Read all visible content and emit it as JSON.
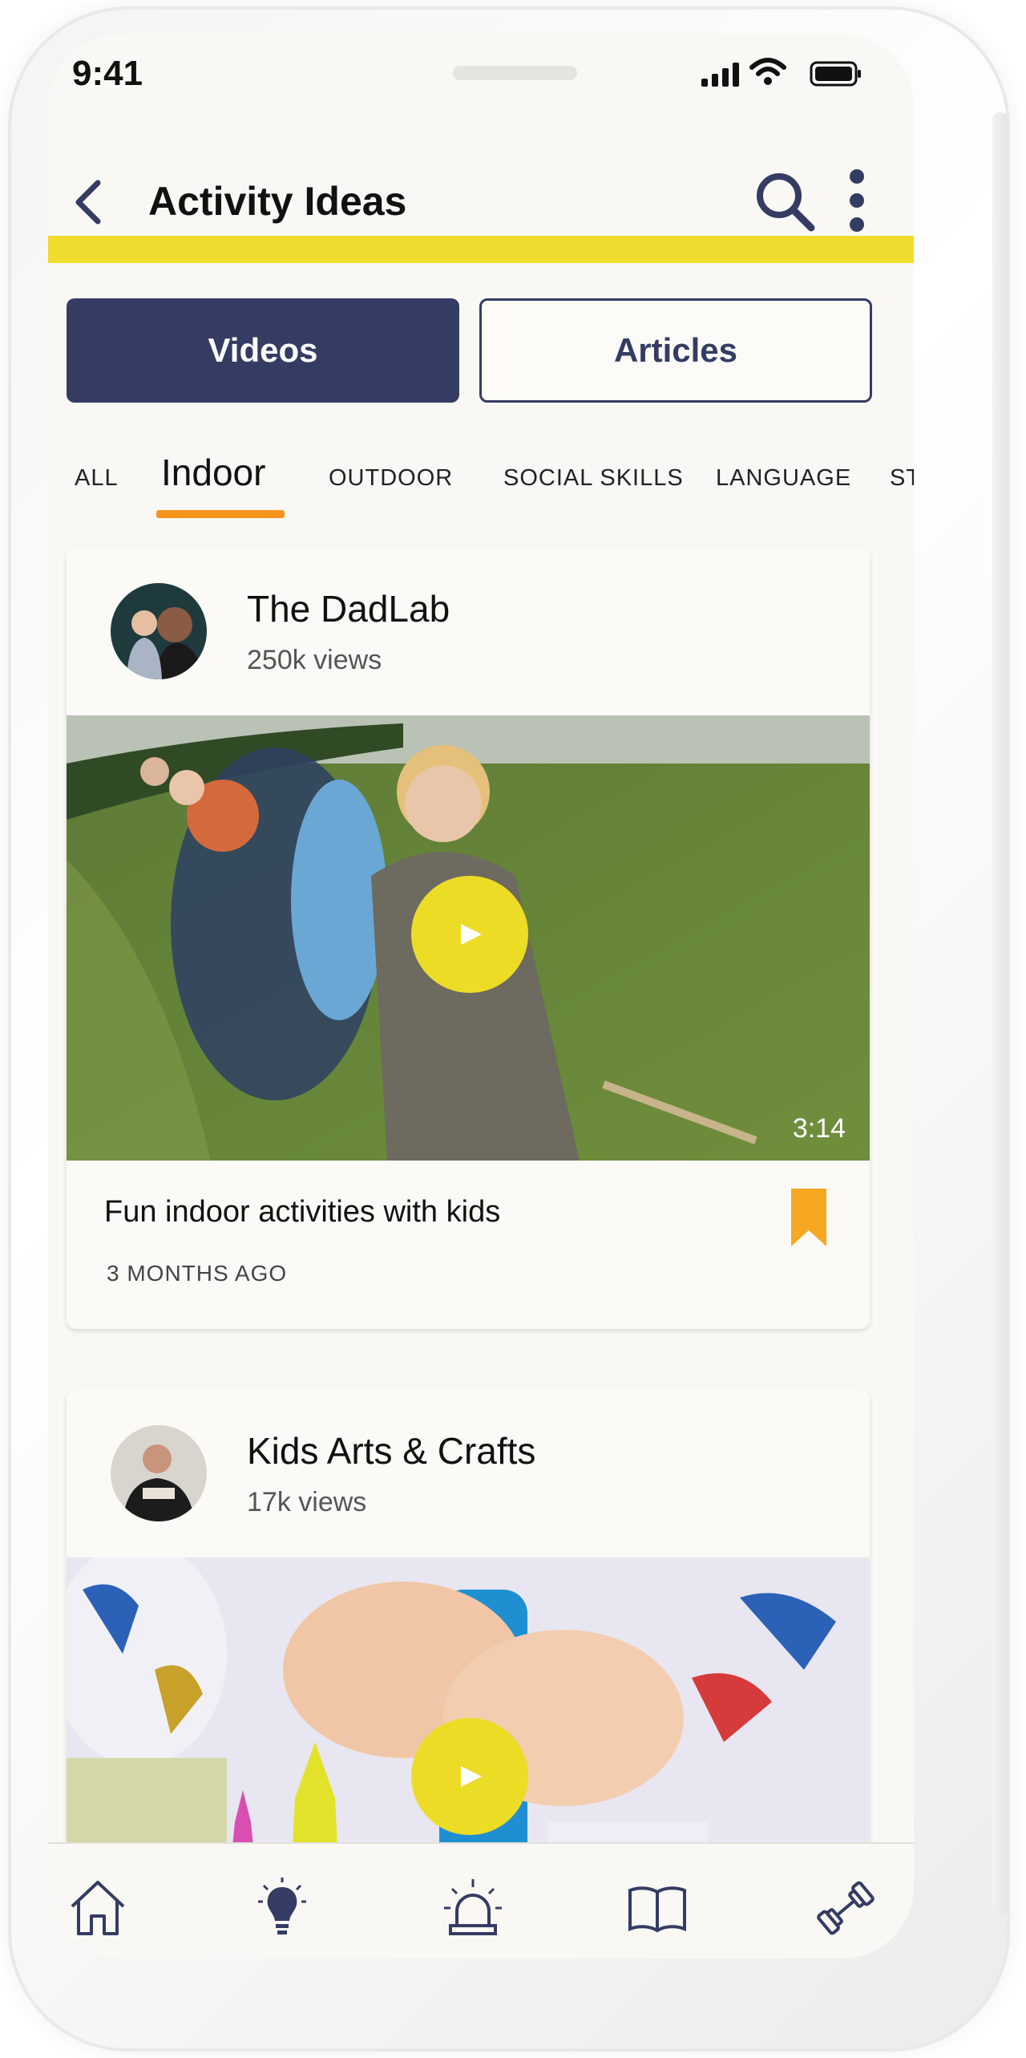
{
  "status_bar": {
    "time": "9:41"
  },
  "header": {
    "title": "Activity Ideas"
  },
  "segments": {
    "videos": "Videos",
    "articles": "Articles",
    "active": "Videos"
  },
  "categories": [
    "ALL",
    "Indoor",
    "OUTDOOR",
    "SOCIAL SKILLS",
    "LANGUAGE",
    "ST"
  ],
  "active_category": "Indoor",
  "cards": [
    {
      "channel": "The DadLab",
      "views": "250k views",
      "duration": "3:14",
      "title": "Fun indoor activities with kids",
      "date": "3 MONTHS AGO"
    },
    {
      "channel": "Kids Arts & Crafts",
      "views": "17k views"
    }
  ],
  "tab_bar": [
    "home-icon",
    "lightbulb-icon",
    "alarm-light-icon",
    "open-book-icon",
    "dumbbell-icon"
  ],
  "colors": {
    "navy": "#353c63",
    "yellow": "#f0dc2e",
    "orange": "#f7941d",
    "background": "#faf8f4"
  }
}
